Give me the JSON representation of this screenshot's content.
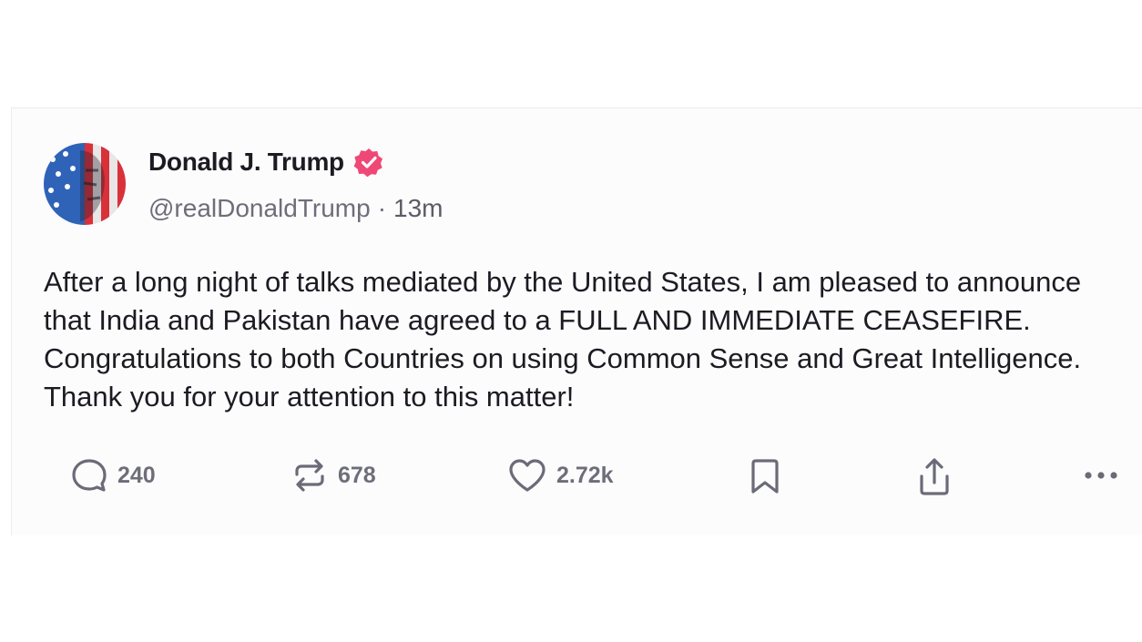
{
  "post": {
    "author": {
      "display_name": "Donald J. Trump",
      "verified": true,
      "handle": "@realDonaldTrump",
      "separator": "·",
      "time": "13m",
      "avatar_icon": "avatar-image"
    },
    "text": "After a long night of talks mediated by the United States, I am pleased to announce that India and Pakistan have agreed to a FULL AND IMMEDIATE CEASEFIRE. Congratulations to both Countries on using Common Sense and Great Intelligence. Thank you for your attention to this matter!",
    "actions": {
      "reply": {
        "icon": "reply-icon",
        "count": "240"
      },
      "repost": {
        "icon": "repost-icon",
        "count": "678"
      },
      "like": {
        "icon": "heart-icon",
        "count": "2.72k"
      },
      "bookmark": {
        "icon": "bookmark-icon"
      },
      "share": {
        "icon": "share-icon"
      },
      "more": {
        "icon": "more-icon"
      }
    }
  },
  "colors": {
    "verified_badge": "#ef4876",
    "text_primary": "#1b1b22",
    "text_secondary": "#6e6e7a",
    "action_icon": "#6b6b78"
  }
}
